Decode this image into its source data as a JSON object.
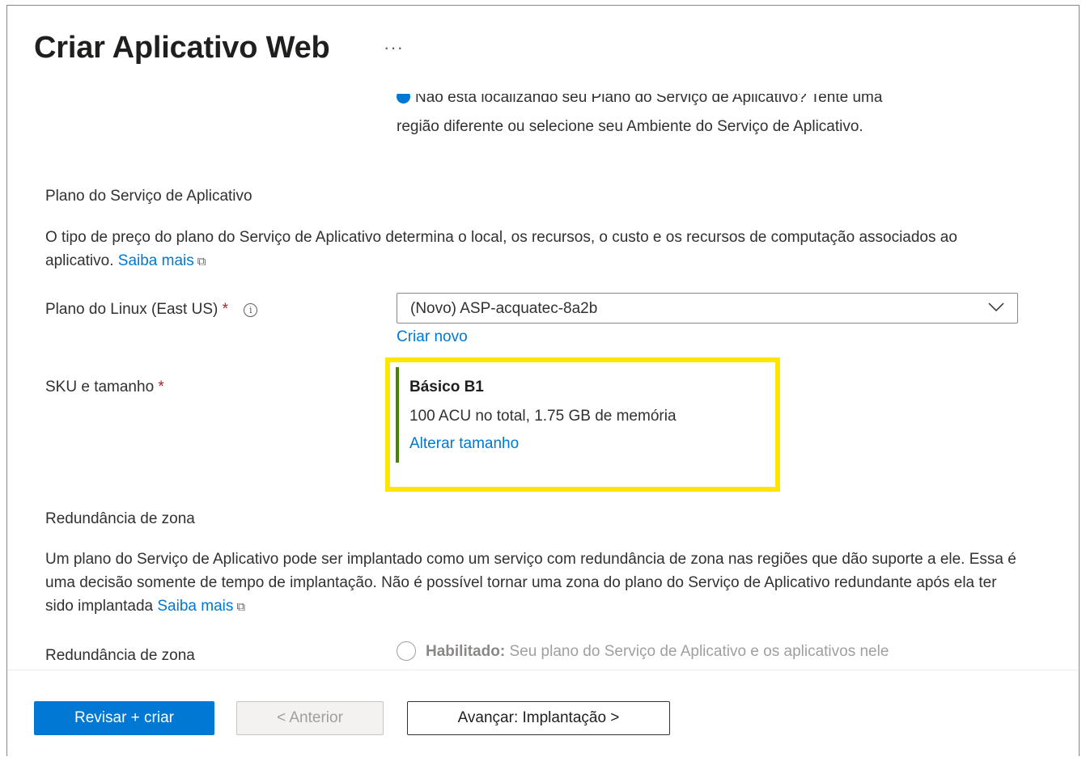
{
  "header": {
    "title": "Criar Aplicativo Web",
    "more_label": "···"
  },
  "region_info": {
    "line1": "Não está localizando seu Plano do Serviço de Aplicativo? Tente uma",
    "line2": "região diferente ou selecione seu Ambiente do Serviço de Aplicativo."
  },
  "app_service_plan": {
    "heading": "Plano do Serviço de Aplicativo",
    "description": "O tipo de preço do plano do Serviço de Aplicativo determina o local, os recursos, o custo e os recursos de computação associados ao aplicativo.",
    "learn_more": "Saiba mais",
    "linux_plan_label": "Plano do Linux (East US)",
    "required_mark": "*",
    "linux_plan_value": "(Novo) ASP-acquatec-8a2b",
    "create_new": "Criar novo",
    "sku_label": "SKU e tamanho",
    "sku_name": "Básico B1",
    "sku_description": "100 ACU no total, 1.75 GB de memória",
    "change_size": "Alterar tamanho"
  },
  "zone_redundancy": {
    "heading": "Redundância de zona",
    "description": "Um plano do Serviço de Aplicativo pode ser implantado como um serviço com redundância de zona nas regiões que dão suporte a ele. Essa é uma decisão somente de tempo de implantação. Não é possível tornar uma zona do plano do Serviço de Aplicativo redundante após ela ter sido implantada",
    "learn_more": "Saiba mais",
    "field_label": "Redundância de zona",
    "enabled_option_bold": "Habilitado:",
    "enabled_option_text": "Seu plano do Serviço de Aplicativo e os aplicativos nele"
  },
  "footer": {
    "review_create": "Revisar + criar",
    "previous": "< Anterior",
    "next": "Avançar: Implantação >"
  },
  "colors": {
    "primary": "#0078d4",
    "highlight": "#ffe600",
    "sku_accent": "#498205",
    "required": "#a4262c"
  }
}
